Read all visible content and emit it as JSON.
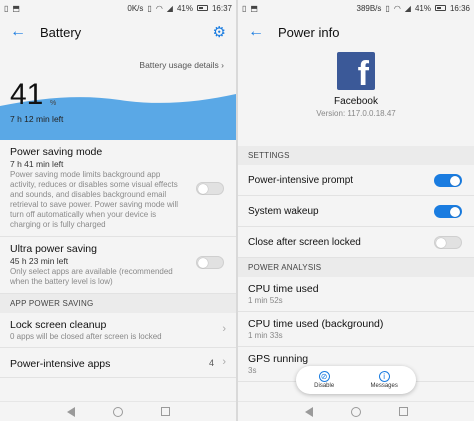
{
  "left": {
    "status": {
      "speed": "0K/s",
      "battery": "41%",
      "time": "16:37"
    },
    "appbar": {
      "title": "Battery"
    },
    "hero": {
      "usage_link": "Battery usage details",
      "level": "41",
      "percent_sign": "%",
      "time_left": "7 h 12 min left",
      "level_fraction": 0.41
    },
    "power_saving": {
      "title": "Power saving mode",
      "time": "7 h 41 min left",
      "desc": "Power saving mode limits background app activity, reduces or disables some visual effects and sounds, and disables background email retrieval to save power. Power saving mode will turn off automatically when your device is charging or is fully charged",
      "enabled": false
    },
    "ultra": {
      "title": "Ultra power saving",
      "time": "45 h 23 min left",
      "desc": "Only select apps are available (recommended when the battery level is low)",
      "enabled": false
    },
    "app_power_header": "APP POWER SAVING",
    "lock_cleanup": {
      "title": "Lock screen cleanup",
      "sub": "0 apps will be closed after screen is locked"
    },
    "intensive_apps": {
      "title": "Power-intensive apps",
      "count": "4"
    }
  },
  "right": {
    "status": {
      "speed": "389B/s",
      "battery": "41%",
      "time": "16:36"
    },
    "appbar": {
      "title": "Power info"
    },
    "app": {
      "name": "Facebook",
      "version": "Version: 117.0.0.18.47",
      "logo_letter": "f"
    },
    "settings_header": "SETTINGS",
    "settings": [
      {
        "label": "Power-intensive prompt",
        "enabled": true
      },
      {
        "label": "System wakeup",
        "enabled": true
      },
      {
        "label": "Close after screen locked",
        "enabled": false
      }
    ],
    "analysis_header": "POWER ANALYSIS",
    "analysis": [
      {
        "label": "CPU time used",
        "value": "1 min 52s"
      },
      {
        "label": "CPU time used (background)",
        "value": "1 min 33s"
      },
      {
        "label": "GPS running",
        "value": "3s"
      }
    ],
    "floating": {
      "disable_label": "Disable",
      "messages_label": "Messages"
    }
  },
  "colors": {
    "accent": "#1a7ce0",
    "wave": "#5aa8e6",
    "facebook": "#3b5998"
  }
}
